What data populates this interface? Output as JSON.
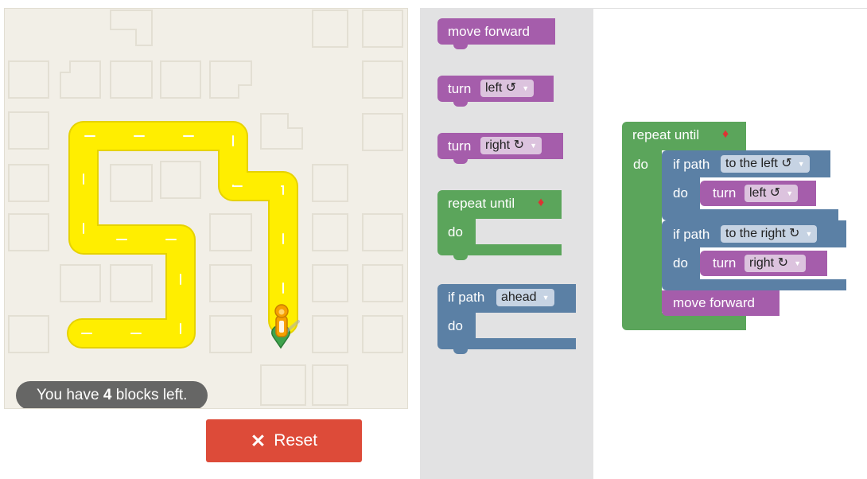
{
  "status": {
    "prefix": "You have",
    "count": "4",
    "suffix": "blocks left."
  },
  "reset": {
    "icon": "✕",
    "label": "Reset"
  },
  "toolbox": {
    "move_forward": "move forward",
    "turn_left": {
      "label": "turn",
      "dir": "left ↺"
    },
    "turn_right": {
      "label": "turn",
      "dir": "right ↻"
    },
    "repeat_until": {
      "label": "repeat until",
      "do": "do"
    },
    "if_path": {
      "label": "if path",
      "option": "ahead",
      "do": "do"
    }
  },
  "program": {
    "repeat_label": "repeat until",
    "do_label": "do",
    "if1": {
      "label": "if path",
      "option": "to the left ↺",
      "do": "do",
      "turn": "turn",
      "dir": "left ↺"
    },
    "if2": {
      "label": "if path",
      "option": "to the right ↻",
      "do": "do",
      "turn": "turn",
      "dir": "right ↻"
    },
    "move": "move forward"
  },
  "colors": {
    "path": "#ffee00",
    "path_border": "#e6d200",
    "reset": "#dd4b39",
    "block_purple": "#a55dab",
    "block_green": "#5ba55b",
    "block_blue": "#5b80a5"
  }
}
